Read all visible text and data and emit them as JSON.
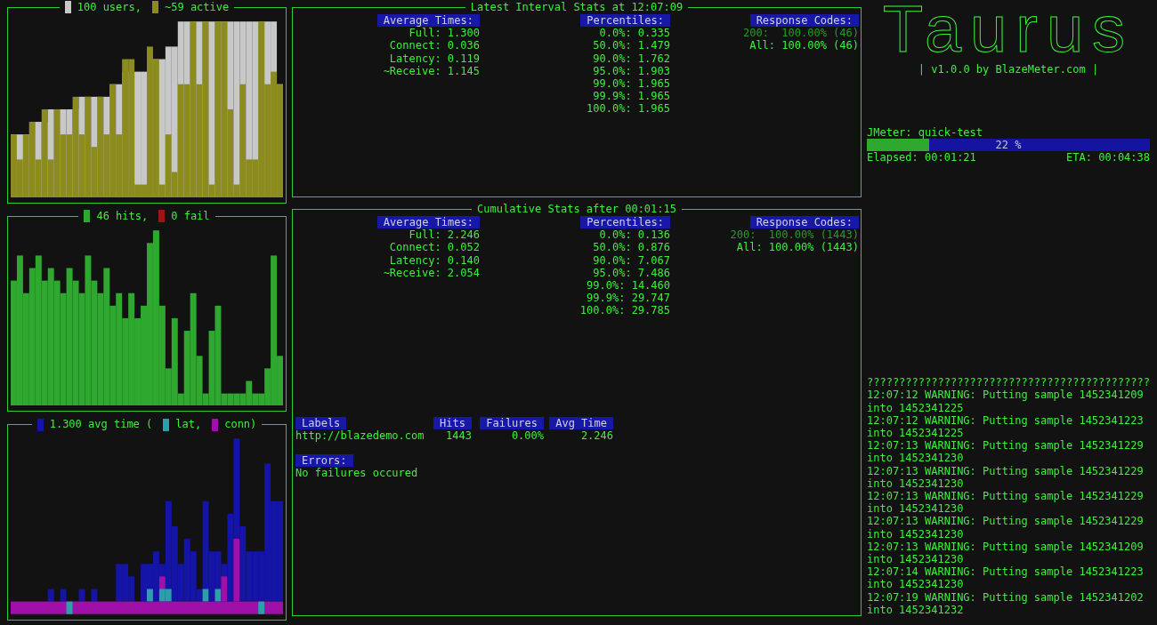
{
  "charts": [
    {
      "legend": [
        {
          "text": "100 users,",
          "color": "#c8c8c8"
        },
        {
          "text": "~59 active",
          "color": "#8c8c1e"
        }
      ]
    },
    {
      "legend": [
        {
          "text": "46 hits,",
          "color": "#2ea82e"
        },
        {
          "text": "0 fail",
          "color": "#a01414"
        }
      ]
    },
    {
      "legend": [
        {
          "text": "1.300 avg time (",
          "color": "#1414a8"
        },
        {
          "text": "lat,",
          "color": "#2aa0a8"
        },
        {
          "text": "conn)",
          "color": "#a010a8"
        }
      ]
    }
  ],
  "panels": [
    {
      "title": "Latest Interval Stats at 12:07:09",
      "average_times": {
        "header": "Average Times:",
        "lines": [
          "Full: 1.300",
          "Connect: 0.036",
          "Latency: 0.119",
          "~Receive: 1.145"
        ]
      },
      "percentiles": {
        "header": "Percentiles:",
        "lines": [
          "0.0%: 0.335",
          "50.0%: 1.479",
          "90.0%: 1.762",
          "95.0%: 1.903",
          "99.0%: 1.965",
          "99.9%: 1.965",
          "100.0%: 1.965"
        ]
      },
      "response_codes": {
        "header": "Response Codes:",
        "lines": [
          {
            "text": "200:  100.00% (46)",
            "dim": true
          },
          {
            "text": "All: 100.00% (46)",
            "dim": false
          }
        ]
      }
    },
    {
      "title": "Cumulative Stats after 00:01:15",
      "average_times": {
        "header": "Average Times:",
        "lines": [
          "Full: 2.246",
          "Connect: 0.052",
          "Latency: 0.140",
          "~Receive: 2.054"
        ]
      },
      "percentiles": {
        "header": "Percentiles:",
        "lines": [
          "0.0%: 0.136",
          "50.0%: 0.876",
          "90.0%: 7.067",
          "95.0%: 7.486",
          "99.0%: 14.460",
          "99.9%: 29.747",
          "100.0%: 29.785"
        ]
      },
      "response_codes": {
        "header": "Response Codes:",
        "lines": [
          {
            "text": "200:  100.00% (1443)",
            "dim": true
          },
          {
            "text": "All: 100.00% (1443)",
            "dim": false
          }
        ]
      },
      "labels_table": {
        "columns": [
          "Labels",
          "Hits",
          "Failures",
          "Avg Time"
        ],
        "rows": [
          [
            "http://blazedemo.com",
            "1443",
            "0.00%",
            "2.246"
          ]
        ]
      },
      "errors": {
        "header": "Errors:",
        "message": "No failures occured"
      }
    }
  ],
  "logo": {
    "text": "Taurus",
    "tagline": "| v1.0.0 by BlazeMeter.com |"
  },
  "progress": {
    "label": "JMeter: quick-test",
    "level": 0.22,
    "percent": "22 %",
    "elapsed": "Elapsed: 00:01:21",
    "eta": "ETA: 00:04:38"
  },
  "log": [
    "????????????????????????????????????????????",
    "12:07:12 WARNING: Putting sample 1452341209",
    "into 1452341225",
    "12:07:12 WARNING: Putting sample 1452341223",
    "into 1452341225",
    "12:07:13 WARNING: Putting sample 1452341229",
    "into 1452341230",
    "12:07:13 WARNING: Putting sample 1452341229",
    "into 1452341230",
    "12:07:13 WARNING: Putting sample 1452341229",
    "into 1452341230",
    "12:07:13 WARNING: Putting sample 1452341229",
    "into 1452341230",
    "12:07:13 WARNING: Putting sample 1452341209",
    "into 1452341230",
    "12:07:14 WARNING: Putting sample 1452341223",
    "into 1452341230",
    "12:07:19 WARNING: Putting sample 1452341202",
    "into 1452341232"
  ]
}
